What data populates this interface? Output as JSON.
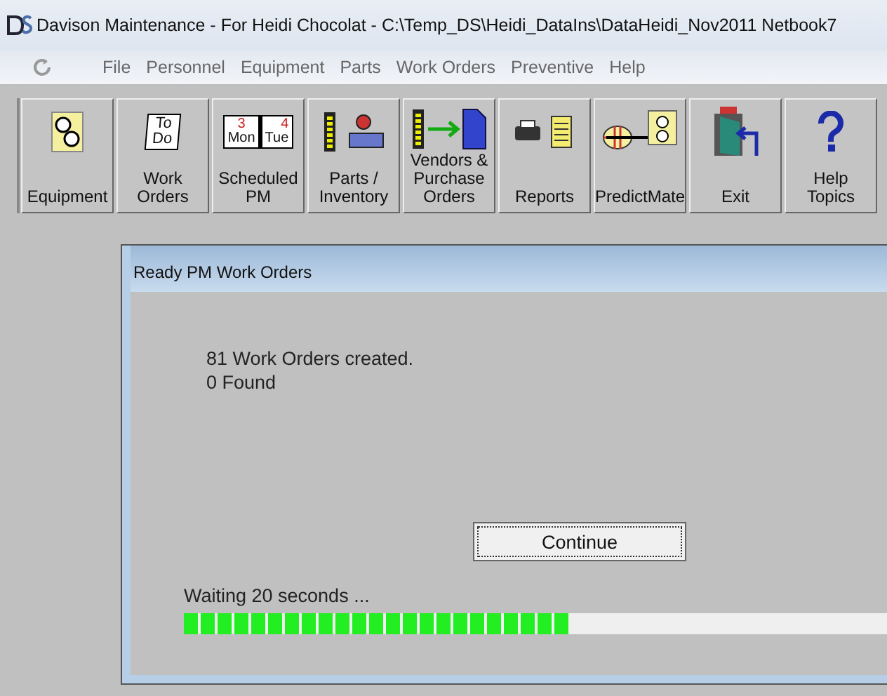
{
  "window": {
    "title": "Davison Maintenance - For Heidi Chocolat - C:\\Temp_DS\\Heidi_DataIns\\DataHeidi_Nov2011  Netbook7"
  },
  "menu": [
    "File",
    "Personnel",
    "Equipment",
    "Parts",
    "Work Orders",
    "Preventive",
    "Help"
  ],
  "toolbar": [
    {
      "lines": [
        "Equipment"
      ]
    },
    {
      "lines": [
        "Work",
        "Orders"
      ],
      "icon_text": [
        "To",
        "Do"
      ]
    },
    {
      "lines": [
        "Scheduled",
        "PM"
      ],
      "icon_text": [
        "3",
        "Mon",
        "4",
        "Tue"
      ]
    },
    {
      "lines": [
        "Parts /",
        "Inventory"
      ]
    },
    {
      "lines": [
        "Vendors &",
        "Purchase",
        "Orders"
      ]
    },
    {
      "lines": [
        "Reports"
      ]
    },
    {
      "lines": [
        "PredictMate"
      ]
    },
    {
      "lines": [
        "Exit"
      ]
    },
    {
      "lines": [
        "Help",
        "Topics"
      ]
    }
  ],
  "dialog": {
    "title": "Ready PM Work Orders",
    "message": [
      "81 Work Orders created.",
      "0 Found"
    ],
    "button": "Continue",
    "status": "Waiting 20 seconds ...",
    "progress": {
      "level": 0.47
    }
  }
}
